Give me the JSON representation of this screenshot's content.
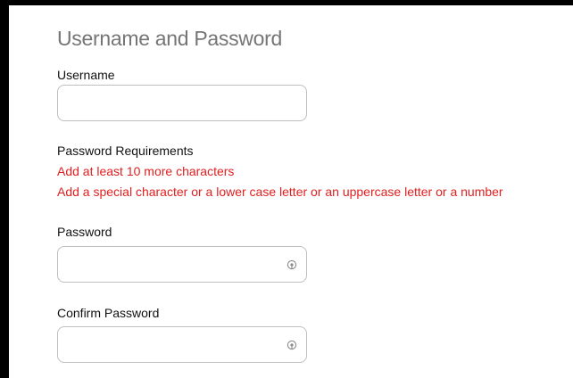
{
  "section": {
    "title": "Username and Password"
  },
  "username": {
    "label": "Username",
    "value": "",
    "placeholder": ""
  },
  "requirements": {
    "label": "Password Requirements",
    "errors": [
      "Add at least 10 more characters",
      "Add a special character or a lower case letter or an uppercase letter or a number"
    ],
    "error_color": "#e02020"
  },
  "password": {
    "label": "Password",
    "value": "",
    "placeholder": "",
    "toggle_icon": "eye-reveal-icon"
  },
  "confirm_password": {
    "label": "Confirm Password",
    "value": "",
    "placeholder": "",
    "toggle_icon": "eye-reveal-icon"
  }
}
